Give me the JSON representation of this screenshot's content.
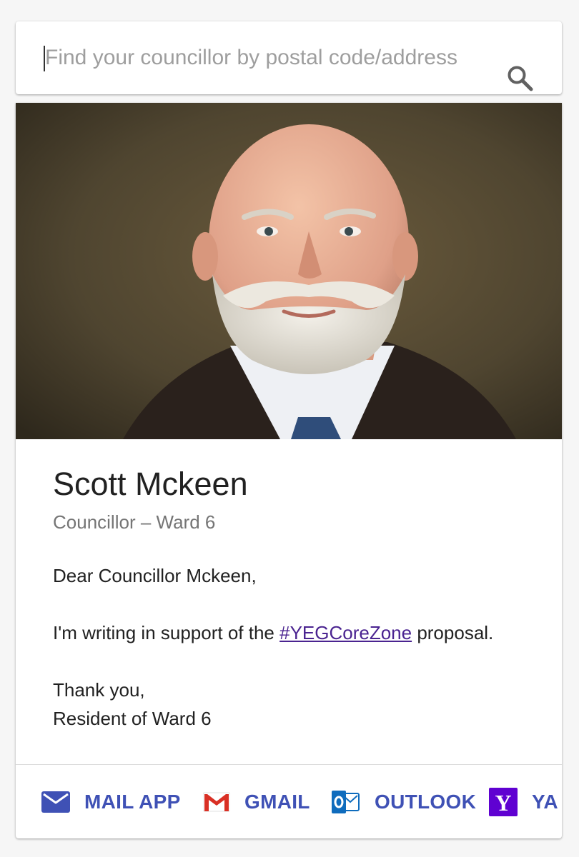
{
  "search": {
    "placeholder": "Find your councillor by postal code/address",
    "value": ""
  },
  "councillor": {
    "name": "Scott Mckeen",
    "role": "Councillor – Ward 6",
    "photo": "portrait-photo"
  },
  "letter": {
    "greeting": "Dear Councillor Mckeen,",
    "body_before": "I'm writing in support of the ",
    "hashtag": "#YEGCoreZone",
    "body_after": " proposal.",
    "closing": "Thank you,",
    "signature": "Resident of Ward 6"
  },
  "email_options": [
    {
      "label": "MAIL APP",
      "icon": "mail-envelope-icon"
    },
    {
      "label": "GMAIL",
      "icon": "gmail-icon"
    },
    {
      "label": "OUTLOOK",
      "icon": "outlook-icon"
    },
    {
      "label": "YA",
      "icon": "yahoo-icon"
    }
  ],
  "colors": {
    "accent": "#3f51b5",
    "link": "#4a2390",
    "background": "#f6f6f6"
  }
}
